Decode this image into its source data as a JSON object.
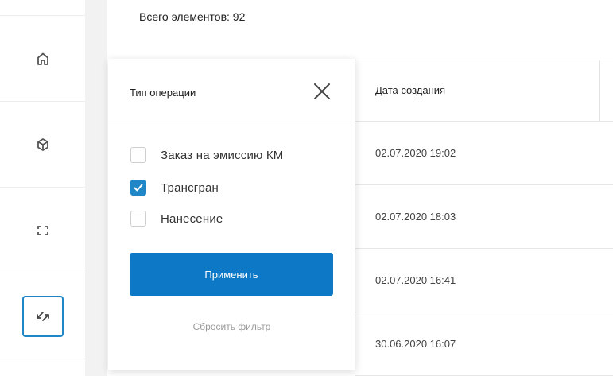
{
  "header": {
    "total_label": "Всего элементов: 92"
  },
  "sidebar": {
    "items": [
      {
        "icon": "home-icon"
      },
      {
        "icon": "cube-icon"
      },
      {
        "icon": "scan-frame-icon"
      },
      {
        "icon": "transfer-arrows-icon",
        "active": true
      }
    ]
  },
  "table": {
    "date_column_label": "Дата создания",
    "rows": [
      {
        "date": "02.07.2020 19:02"
      },
      {
        "date": "02.07.2020 18:03"
      },
      {
        "date": "02.07.2020 16:41"
      },
      {
        "date": "30.06.2020 16:07"
      }
    ]
  },
  "filter": {
    "title": "Тип операции",
    "options": [
      {
        "label": "Заказ на эмиссию КМ",
        "checked": false
      },
      {
        "label": "Трансгран",
        "checked": true
      },
      {
        "label": "Нанесение",
        "checked": false
      }
    ],
    "apply_label": "Применить",
    "reset_label": "Сбросить фильтр"
  },
  "colors": {
    "accent": "#0d79c6",
    "checkbox_checked": "#1f86c8"
  }
}
